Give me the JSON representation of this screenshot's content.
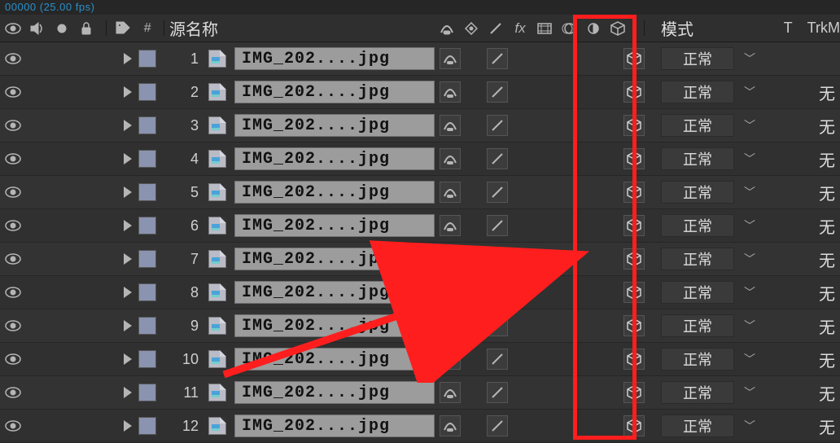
{
  "top_info": "00000 (25.00 fps)",
  "header": {
    "source_label": "源名称",
    "mode_label": "模式",
    "t_label": "T",
    "track_label": "TrkM"
  },
  "layers": [
    {
      "idx": 1,
      "name": "IMG_202....jpg",
      "mode": "正常",
      "trk": ""
    },
    {
      "idx": 2,
      "name": "IMG_202....jpg",
      "mode": "正常",
      "trk": "无"
    },
    {
      "idx": 3,
      "name": "IMG_202....jpg",
      "mode": "正常",
      "trk": "无"
    },
    {
      "idx": 4,
      "name": "IMG_202....jpg",
      "mode": "正常",
      "trk": "无"
    },
    {
      "idx": 5,
      "name": "IMG_202....jpg",
      "mode": "正常",
      "trk": "无"
    },
    {
      "idx": 6,
      "name": "IMG_202....jpg",
      "mode": "正常",
      "trk": "无"
    },
    {
      "idx": 7,
      "name": "IMG_202....jpg",
      "mode": "正常",
      "trk": "无"
    },
    {
      "idx": 8,
      "name": "IMG_202....jpg",
      "mode": "正常",
      "trk": "无"
    },
    {
      "idx": 9,
      "name": "IMG_202....jpg",
      "mode": "正常",
      "trk": "无"
    },
    {
      "idx": 10,
      "name": "IMG_202....jpg",
      "mode": "正常",
      "trk": "无"
    },
    {
      "idx": 11,
      "name": "IMG_202....jpg",
      "mode": "正常",
      "trk": "无"
    },
    {
      "idx": 12,
      "name": "IMG_202....jpg",
      "mode": "正常",
      "trk": "无"
    }
  ]
}
